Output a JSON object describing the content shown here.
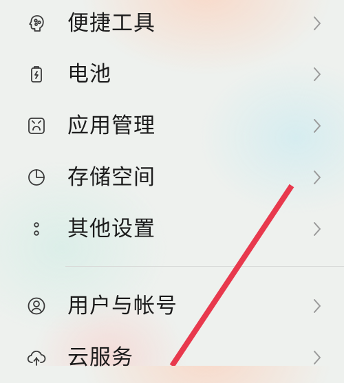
{
  "settings_items": [
    {
      "label": "便捷工具",
      "icon": "convenience-tools-icon"
    },
    {
      "label": "电池",
      "icon": "battery-icon"
    },
    {
      "label": "应用管理",
      "icon": "app-management-icon"
    },
    {
      "label": "存储空间",
      "icon": "storage-pie-icon"
    },
    {
      "label": "其他设置",
      "icon": "more-dots-icon"
    },
    {
      "label": "用户与帐号",
      "icon": "user-account-icon"
    },
    {
      "label": "云服务",
      "icon": "cloud-service-icon"
    }
  ],
  "annotation": {
    "color": "#e8394d"
  }
}
